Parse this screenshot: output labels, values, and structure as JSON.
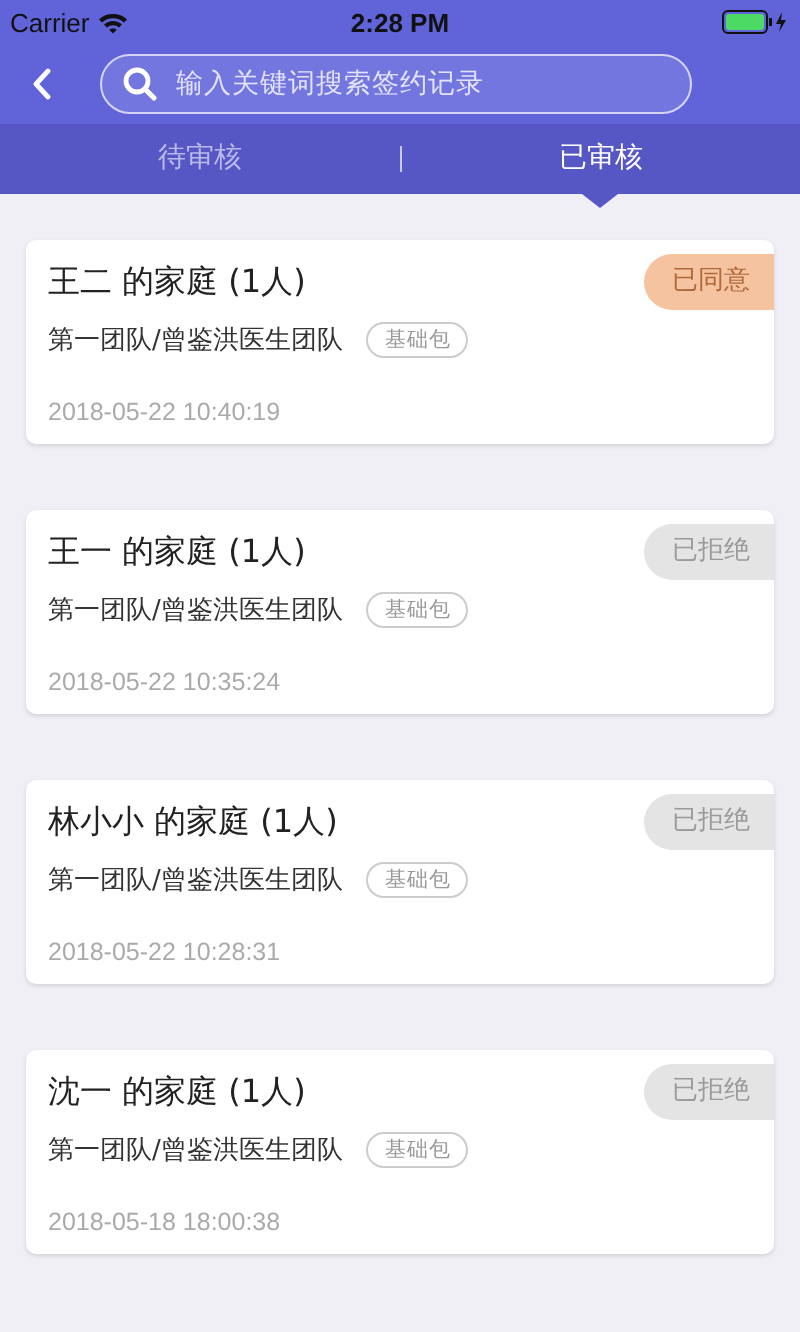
{
  "status_bar": {
    "carrier": "Carrier",
    "time": "2:28 PM"
  },
  "search": {
    "placeholder": "输入关键词搜索签约记录"
  },
  "tabs": [
    {
      "label": "待审核",
      "selected": false
    },
    {
      "label": "已审核",
      "selected": true
    }
  ],
  "records": [
    {
      "title": "王二 的家庭 (1人)",
      "team": "第一团队/曾鉴洪医生团队",
      "package": "基础包",
      "time": "2018-05-22 10:40:19",
      "status": "已同意",
      "kind": "agreed"
    },
    {
      "title": "王一 的家庭 (1人)",
      "team": "第一团队/曾鉴洪医生团队",
      "package": "基础包",
      "time": "2018-05-22 10:35:24",
      "status": "已拒绝",
      "kind": "rejected"
    },
    {
      "title": "林小小 的家庭 (1人)",
      "team": "第一团队/曾鉴洪医生团队",
      "package": "基础包",
      "time": "2018-05-22 10:28:31",
      "status": "已拒绝",
      "kind": "rejected"
    },
    {
      "title": "沈一 的家庭 (1人)",
      "team": "第一团队/曾鉴洪医生团队",
      "package": "基础包",
      "time": "2018-05-18 18:00:38",
      "status": "已拒绝",
      "kind": "rejected"
    }
  ]
}
